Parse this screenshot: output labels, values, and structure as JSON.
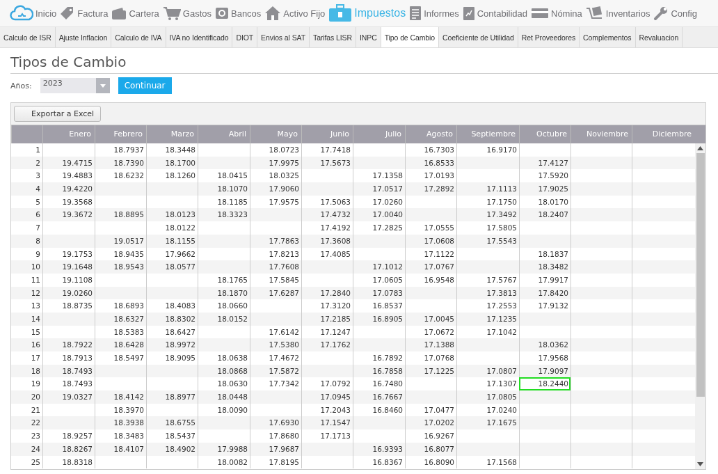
{
  "nav": [
    {
      "label": "Inicio",
      "selected": false
    },
    {
      "label": "Factura",
      "selected": false
    },
    {
      "label": "Cartera",
      "selected": false
    },
    {
      "label": "Gastos",
      "selected": false
    },
    {
      "label": "Bancos",
      "selected": false
    },
    {
      "label": "Activo Fijo",
      "selected": false
    },
    {
      "label": "Impuestos",
      "selected": true
    },
    {
      "label": "Informes",
      "selected": false
    },
    {
      "label": "Contabilidad",
      "selected": false
    },
    {
      "label": "Nómina",
      "selected": false
    },
    {
      "label": "Inventarios",
      "selected": false
    },
    {
      "label": "Config",
      "selected": false
    }
  ],
  "tabs": [
    {
      "label": "Calculo de ISR",
      "selected": false
    },
    {
      "label": "Ajuste Inflacion",
      "selected": false
    },
    {
      "label": "Calculo de IVA",
      "selected": false
    },
    {
      "label": "IVA no Identificado",
      "selected": false
    },
    {
      "label": "DIOT",
      "selected": false
    },
    {
      "label": "Envios al SAT",
      "selected": false
    },
    {
      "label": "Tarifas LISR",
      "selected": false
    },
    {
      "label": "INPC",
      "selected": false
    },
    {
      "label": "Tipo de Cambio",
      "selected": true
    },
    {
      "label": "Coeficiente de Utilidad",
      "selected": false
    },
    {
      "label": "Ret Proveedores",
      "selected": false
    },
    {
      "label": "Complementos",
      "selected": false
    },
    {
      "label": "Revaluacion",
      "selected": false
    }
  ],
  "title": "Tipos de Cambio",
  "year_filter": {
    "label": "Años:",
    "value": "2023"
  },
  "continue_button": "Continuar",
  "export_button": "Exportar a Excel",
  "table": {
    "columns": [
      "Enero",
      "Febrero",
      "Marzo",
      "Abril",
      "Mayo",
      "Junio",
      "Julio",
      "Agosto",
      "Septiembre",
      "Octubre",
      "Noviembre",
      "Diciembre"
    ],
    "rows": [
      {
        "day": "1",
        "cells": [
          null,
          "18.7937",
          "18.3448",
          null,
          "18.0723",
          "17.7418",
          null,
          "16.7303",
          "16.9170",
          null,
          null,
          null
        ]
      },
      {
        "day": "2",
        "cells": [
          "19.4715",
          "18.7390",
          "18.1700",
          null,
          "17.9975",
          "17.5673",
          null,
          "16.8533",
          null,
          "17.4127",
          null,
          null
        ]
      },
      {
        "day": "3",
        "cells": [
          "19.4883",
          "18.6232",
          "18.1260",
          "18.0415",
          "18.0325",
          null,
          "17.1358",
          "17.0193",
          null,
          "17.5920",
          null,
          null
        ]
      },
      {
        "day": "4",
        "cells": [
          "19.4220",
          null,
          null,
          "18.1070",
          "17.9060",
          null,
          "17.0517",
          "17.2892",
          "17.1113",
          "17.9025",
          null,
          null
        ]
      },
      {
        "day": "5",
        "cells": [
          "19.3568",
          null,
          null,
          "18.1185",
          "17.9575",
          "17.5063",
          "17.0260",
          null,
          "17.1750",
          "18.0170",
          null,
          null
        ]
      },
      {
        "day": "6",
        "cells": [
          "19.3672",
          "18.8895",
          "18.0123",
          "18.3323",
          null,
          "17.4732",
          "17.0040",
          null,
          "17.3492",
          "18.2407",
          null,
          null
        ]
      },
      {
        "day": "7",
        "cells": [
          null,
          null,
          "18.0122",
          null,
          null,
          "17.4192",
          "17.2825",
          "17.0555",
          "17.5805",
          null,
          null,
          null
        ]
      },
      {
        "day": "8",
        "cells": [
          null,
          "19.0517",
          "18.1155",
          null,
          "17.7863",
          "17.3608",
          null,
          "17.0608",
          "17.5543",
          null,
          null,
          null
        ]
      },
      {
        "day": "9",
        "cells": [
          "19.1753",
          "18.9435",
          "17.9662",
          null,
          "17.8213",
          "17.4085",
          null,
          "17.1122",
          null,
          "18.1837",
          null,
          null
        ]
      },
      {
        "day": "10",
        "cells": [
          "19.1648",
          "18.9543",
          "18.0577",
          null,
          "17.7608",
          null,
          "17.1012",
          "17.0767",
          null,
          "18.3482",
          null,
          null
        ]
      },
      {
        "day": "11",
        "cells": [
          "19.1108",
          null,
          null,
          "18.1765",
          "17.5845",
          null,
          "17.0605",
          "16.9548",
          "17.5767",
          "17.9917",
          null,
          null
        ]
      },
      {
        "day": "12",
        "cells": [
          "19.0260",
          null,
          null,
          "18.1870",
          "17.6287",
          "17.2840",
          "17.0783",
          null,
          "17.3813",
          "17.8420",
          null,
          null
        ]
      },
      {
        "day": "13",
        "cells": [
          "18.8735",
          "18.6893",
          "18.4083",
          "18.0660",
          null,
          "17.3120",
          "16.8537",
          null,
          "17.2553",
          "17.9132",
          null,
          null
        ]
      },
      {
        "day": "14",
        "cells": [
          null,
          "18.6327",
          "18.8302",
          "18.0152",
          null,
          "17.2185",
          "16.8905",
          "17.0045",
          "17.1235",
          null,
          null,
          null
        ]
      },
      {
        "day": "15",
        "cells": [
          null,
          "18.5383",
          "18.6427",
          null,
          "17.6142",
          "17.1247",
          null,
          "17.0672",
          "17.1042",
          null,
          null,
          null
        ]
      },
      {
        "day": "16",
        "cells": [
          "18.7922",
          "18.6428",
          "18.9972",
          null,
          "17.5380",
          "17.1762",
          null,
          "17.1388",
          null,
          "18.0362",
          null,
          null
        ]
      },
      {
        "day": "17",
        "cells": [
          "18.7913",
          "18.5497",
          "18.9095",
          "18.0638",
          "17.4672",
          null,
          "16.7892",
          "17.0768",
          null,
          "17.9568",
          null,
          null
        ]
      },
      {
        "day": "18",
        "cells": [
          "18.7493",
          null,
          null,
          "18.0868",
          "17.5872",
          null,
          "16.7858",
          "17.1225",
          "17.0807",
          "17.9097",
          null,
          null
        ]
      },
      {
        "day": "19",
        "cells": [
          "18.7493",
          null,
          null,
          "18.0630",
          "17.7342",
          "17.0792",
          "16.7480",
          null,
          "17.1307",
          {
            "value": "18.2440",
            "selected": true
          },
          null,
          null
        ]
      },
      {
        "day": "20",
        "cells": [
          "19.0327",
          "18.4142",
          "18.8977",
          "18.0448",
          null,
          "17.0945",
          "16.7667",
          null,
          "17.0805",
          null,
          null,
          null
        ]
      },
      {
        "day": "21",
        "cells": [
          null,
          "18.3970",
          null,
          "18.0090",
          null,
          "17.2043",
          "16.8460",
          "17.0477",
          "17.0240",
          null,
          null,
          null
        ]
      },
      {
        "day": "22",
        "cells": [
          null,
          "18.3938",
          "18.6755",
          null,
          "17.6930",
          "17.1547",
          null,
          "17.0202",
          "17.1675",
          null,
          null,
          null
        ]
      },
      {
        "day": "23",
        "cells": [
          "18.9257",
          "18.3483",
          "18.5437",
          null,
          "17.8680",
          "17.1713",
          null,
          "16.9267",
          null,
          null,
          null,
          null
        ]
      },
      {
        "day": "24",
        "cells": [
          "18.8267",
          "18.4107",
          "18.4902",
          "17.9988",
          "17.9687",
          null,
          "16.9393",
          "16.8077",
          null,
          null,
          null,
          null
        ]
      },
      {
        "day": "25",
        "cells": [
          "18.8318",
          null,
          null,
          "18.0082",
          "17.8195",
          null,
          "16.8367",
          "16.8090",
          "17.1568",
          null,
          null,
          null
        ]
      }
    ]
  }
}
